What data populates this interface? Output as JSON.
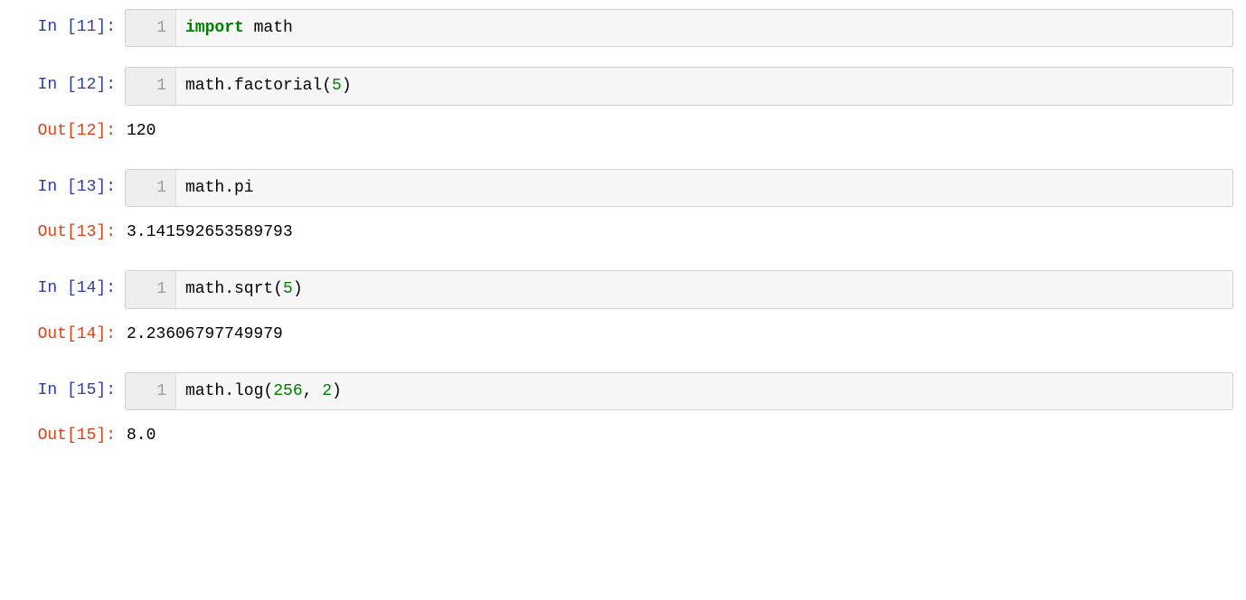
{
  "cells": [
    {
      "in_num": "11",
      "line_no": "1",
      "code_html": "<span class='kw'>import</span> math"
    },
    {
      "in_num": "12",
      "line_no": "1",
      "code_html": "math.factorial(<span class='num'>5</span>)",
      "out_num": "12",
      "out_text": "120"
    },
    {
      "in_num": "13",
      "line_no": "1",
      "code_html": "math.pi",
      "out_num": "13",
      "out_text": "3.141592653589793"
    },
    {
      "in_num": "14",
      "line_no": "1",
      "code_html": "math.sqrt(<span class='num'>5</span>)",
      "out_num": "14",
      "out_text": "2.23606797749979"
    },
    {
      "in_num": "15",
      "line_no": "1",
      "code_html": "math.log(<span class='num'>256</span>, <span class='num'>2</span>)",
      "out_num": "15",
      "out_text": "8.0"
    }
  ],
  "labels": {
    "in": "In ",
    "out": "Out"
  }
}
